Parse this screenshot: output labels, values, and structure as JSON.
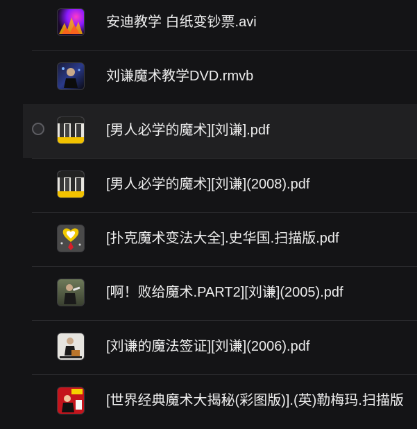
{
  "files": [
    {
      "name": "安迪教学 白纸变钞票.avi",
      "thumb_icon": "video-thumbnail-icon",
      "hovered": false
    },
    {
      "name": "刘谦魔术教学DVD.rmvb",
      "thumb_icon": "video-thumbnail-icon",
      "hovered": false
    },
    {
      "name": "[男人必学的魔术][刘谦].pdf",
      "thumb_icon": "book-cover-icon",
      "hovered": true
    },
    {
      "name": "[男人必学的魔术][刘谦](2008).pdf",
      "thumb_icon": "book-cover-icon",
      "hovered": false
    },
    {
      "name": "[扑克魔术变法大全].史华国.扫描版.pdf",
      "thumb_icon": "book-cover-icon",
      "hovered": false
    },
    {
      "name": "[啊！败给魔术.PART2][刘谦](2005).pdf",
      "thumb_icon": "book-cover-icon",
      "hovered": false
    },
    {
      "name": "[刘谦的魔法签证][刘谦](2006).pdf",
      "thumb_icon": "book-cover-icon",
      "hovered": false
    },
    {
      "name": "[世界经典魔术大揭秘(彩图版)].(英)勒梅玛.扫描版",
      "thumb_icon": "book-cover-icon",
      "hovered": false
    }
  ],
  "colors": {
    "background": "#141416",
    "hover_row": "#202022",
    "text": "#ededed",
    "divider": "#2a2a2d"
  }
}
